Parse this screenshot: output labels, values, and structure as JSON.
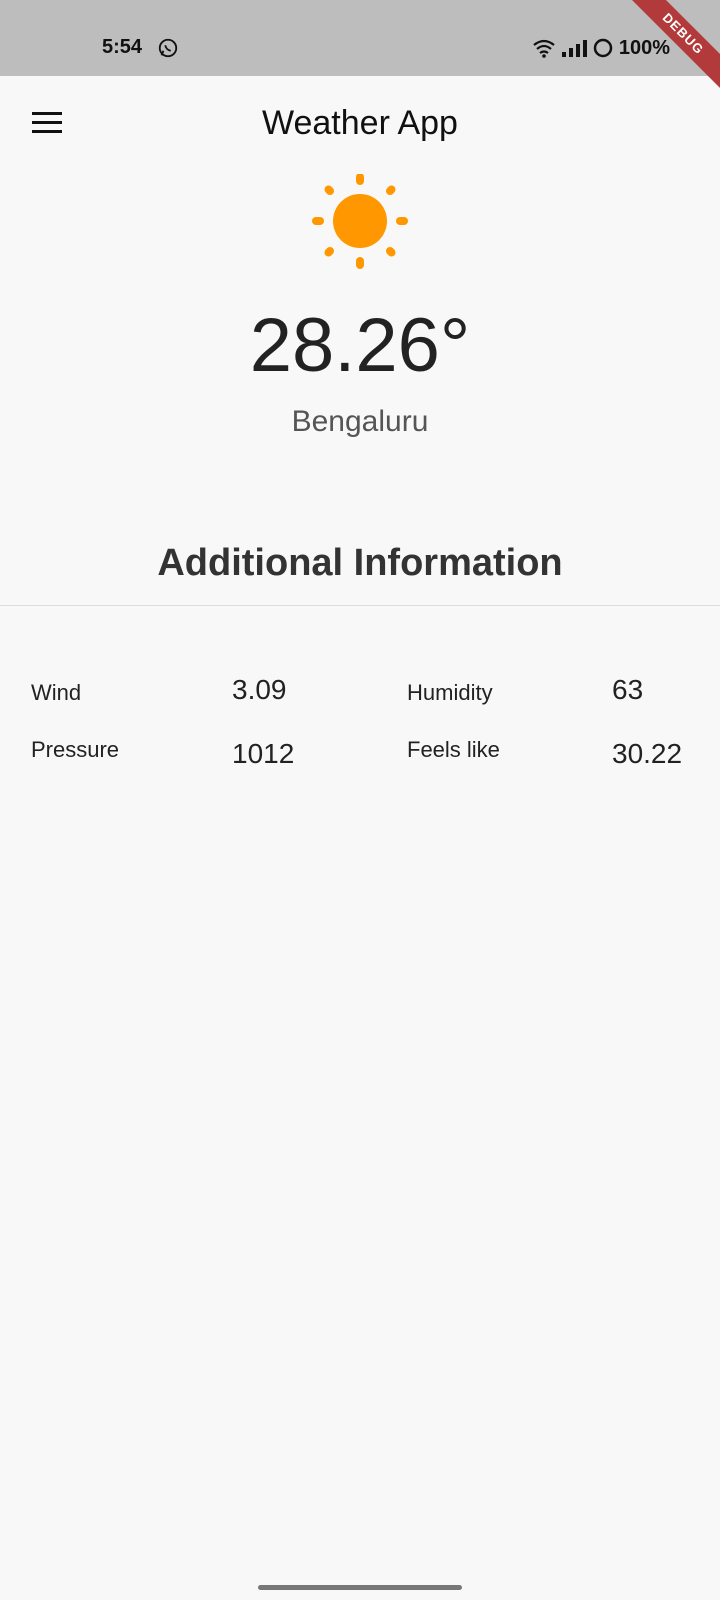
{
  "status_bar": {
    "time": "5:54",
    "battery": "100%"
  },
  "debug_banner": "DEBUG",
  "app_bar": {
    "title": "Weather App"
  },
  "current": {
    "temperature": "28.26°",
    "city": "Bengaluru",
    "icon": "sun-icon"
  },
  "additional": {
    "title": "Additional Information",
    "items": [
      {
        "label": "Wind",
        "value": "3.09"
      },
      {
        "label": "Humidity",
        "value": "63"
      },
      {
        "label": "Pressure",
        "value": "1012"
      },
      {
        "label": "Feels like",
        "value": "30.22"
      }
    ]
  },
  "colors": {
    "accent": "#ff9800",
    "status_bar": "#bdbdbd",
    "background": "#f8f8f8",
    "debug": "#b33a3a"
  }
}
